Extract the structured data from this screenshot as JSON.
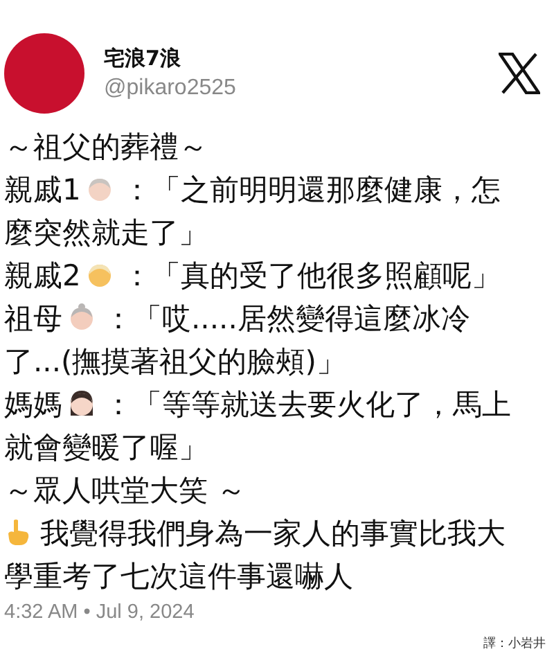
{
  "account": {
    "name": "宅浪7浪",
    "handle": "@pikaro2525"
  },
  "lines": [
    {
      "kind": "heading",
      "text": [
        "～祖父的葬禮～"
      ]
    },
    {
      "kind": "dialogue",
      "speaker": "親戚1",
      "text": [
        "：「之前明明還那麼健康，怎",
        "麼突然就走了」"
      ]
    },
    {
      "kind": "dialogue",
      "speaker": "親戚2",
      "text": [
        "：「真的受了他很多照顧呢」"
      ]
    },
    {
      "kind": "dialogue",
      "speaker": "祖母",
      "text": [
        "：「哎.....居然變得這麼冰冷",
        "了...(撫摸著祖父的臉頰)」"
      ]
    },
    {
      "kind": "dialogue",
      "speaker": "媽媽",
      "text": [
        "：「等等就送去要火化了，馬上",
        "就會變暖了喔」"
      ]
    },
    {
      "kind": "heading",
      "text": [
        "～眾人哄堂大笑 ～"
      ]
    },
    {
      "kind": "pointer",
      "text": [
        "我覺得我們身為一家人的事實比我大",
        "學重考了七次這件事還嚇人"
      ]
    }
  ],
  "timestamp": "4:32 AM • Jul 9, 2024",
  "credit": "譯：小岩井"
}
